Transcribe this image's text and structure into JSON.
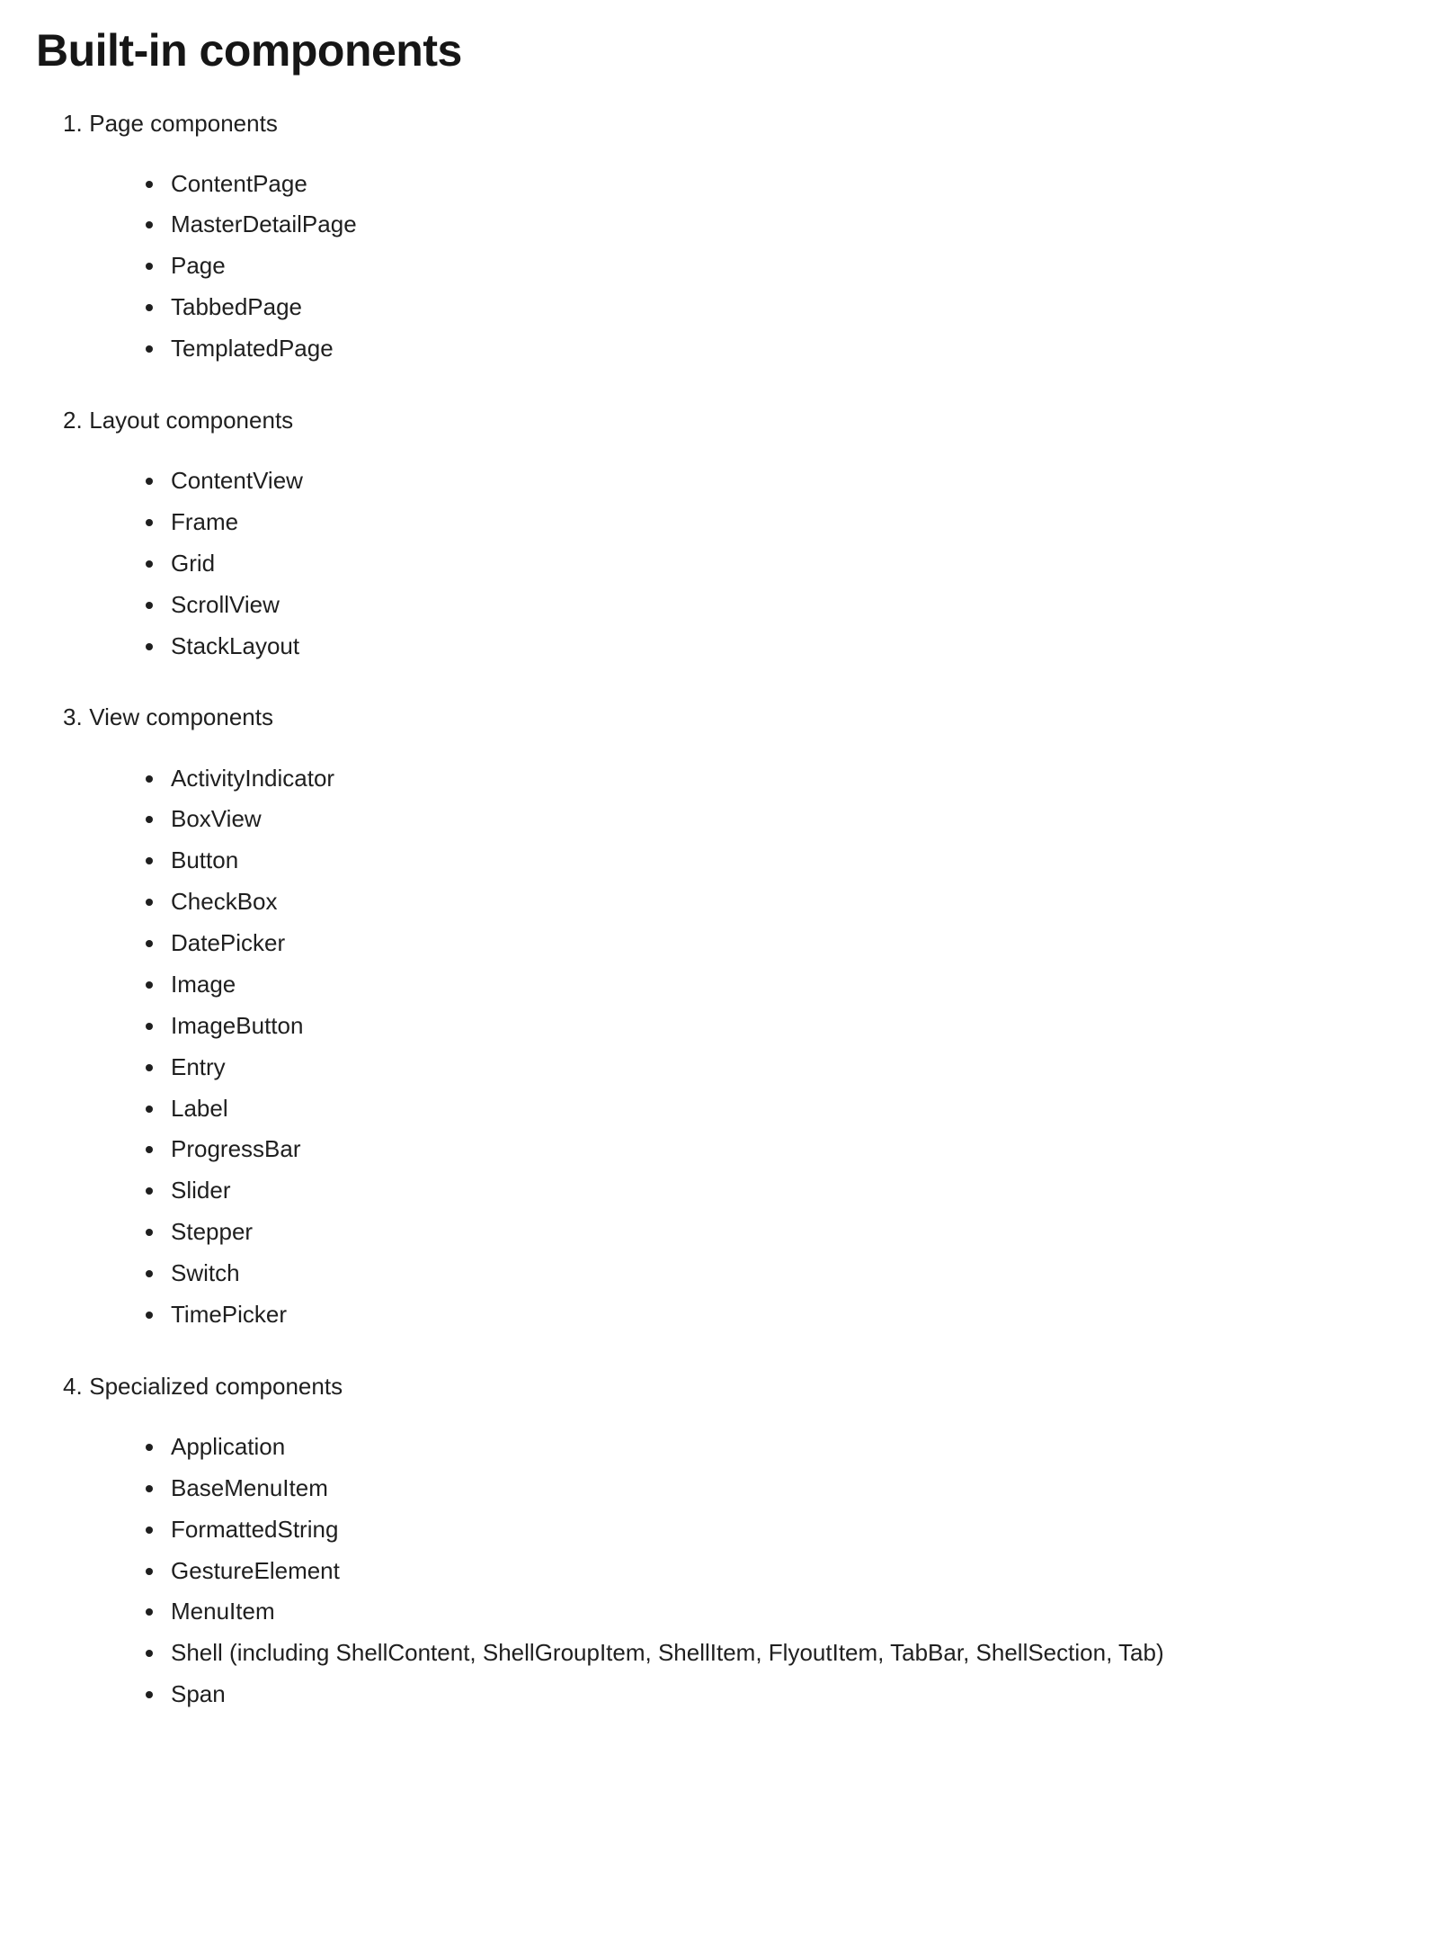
{
  "document": {
    "title": "Built-in components",
    "sections": [
      {
        "number": "1.",
        "heading": "Page components",
        "items": [
          "ContentPage",
          "MasterDetailPage",
          "Page",
          "TabbedPage",
          "TemplatedPage"
        ]
      },
      {
        "number": "2.",
        "heading": "Layout components",
        "items": [
          "ContentView",
          "Frame",
          "Grid",
          "ScrollView",
          "StackLayout"
        ]
      },
      {
        "number": "3.",
        "heading": "View components",
        "items": [
          "ActivityIndicator",
          "BoxView",
          "Button",
          "CheckBox",
          "DatePicker",
          "Image",
          "ImageButton",
          "Entry",
          "Label",
          "ProgressBar",
          "Slider",
          "Stepper",
          "Switch",
          "TimePicker"
        ]
      },
      {
        "number": "4.",
        "heading": "Specialized components",
        "items": [
          "Application",
          "BaseMenuItem",
          "FormattedString",
          "GestureElement",
          "MenuItem",
          "Shell (including ShellContent, ShellGroupItem, ShellItem, FlyoutItem, TabBar, ShellSection, Tab)",
          "Span"
        ]
      }
    ]
  },
  "colors": {
    "text": "#1f1f1f",
    "title": "#161616",
    "background": "#ffffff"
  }
}
